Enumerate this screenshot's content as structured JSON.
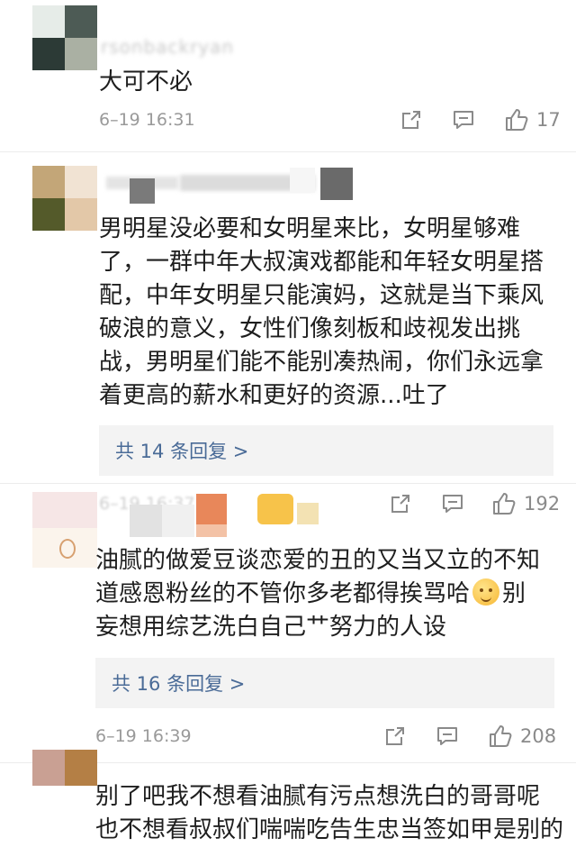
{
  "comments": [
    {
      "id": "c1",
      "text_lines": [
        "大可不必"
      ],
      "time": "6–19 16:31",
      "like_count": "17"
    },
    {
      "id": "c2",
      "text_lines": [
        "男明星没必要和女明星来比，女明星够难",
        "了，一群中年大叔演戏都能和年轻女明星搭",
        "配，中年女明星只能演妈，这就是当下乘风",
        "破浪的意义，女性们像刻板和歧视发出挑",
        "战，男明星们能不能别凑热闹，你们永远拿",
        "着更高的薪水和更好的资源...吐了"
      ],
      "replies_label": "共 14 条回复 >"
    },
    {
      "id": "c3",
      "time": "6–19 16:37",
      "like_count": "192",
      "text_lines": [
        "油腻的做爱豆谈恋爱的丑的又当又立的不知",
        "道感恩粉丝的不管你多老都得挨骂哈",
        "别",
        "妄想用综艺洗白自己艹努力的人设"
      ],
      "replies_label": "共 16 条回复 >"
    },
    {
      "id": "c4",
      "time": "6–19 16:39",
      "like_count": "208",
      "text_lines": [
        "别了吧我不想看油腻有污点想洗白的哥哥呢",
        "也不想看叔叔们喘喘吃告生忠当签如甲是别的"
      ]
    }
  ],
  "icons": [
    "share-icon",
    "comment-icon",
    "like-icon"
  ],
  "colors": {
    "reply_link": "#4a6b97",
    "time": "#9a9a9a",
    "reply_bg": "#f3f3f3"
  }
}
